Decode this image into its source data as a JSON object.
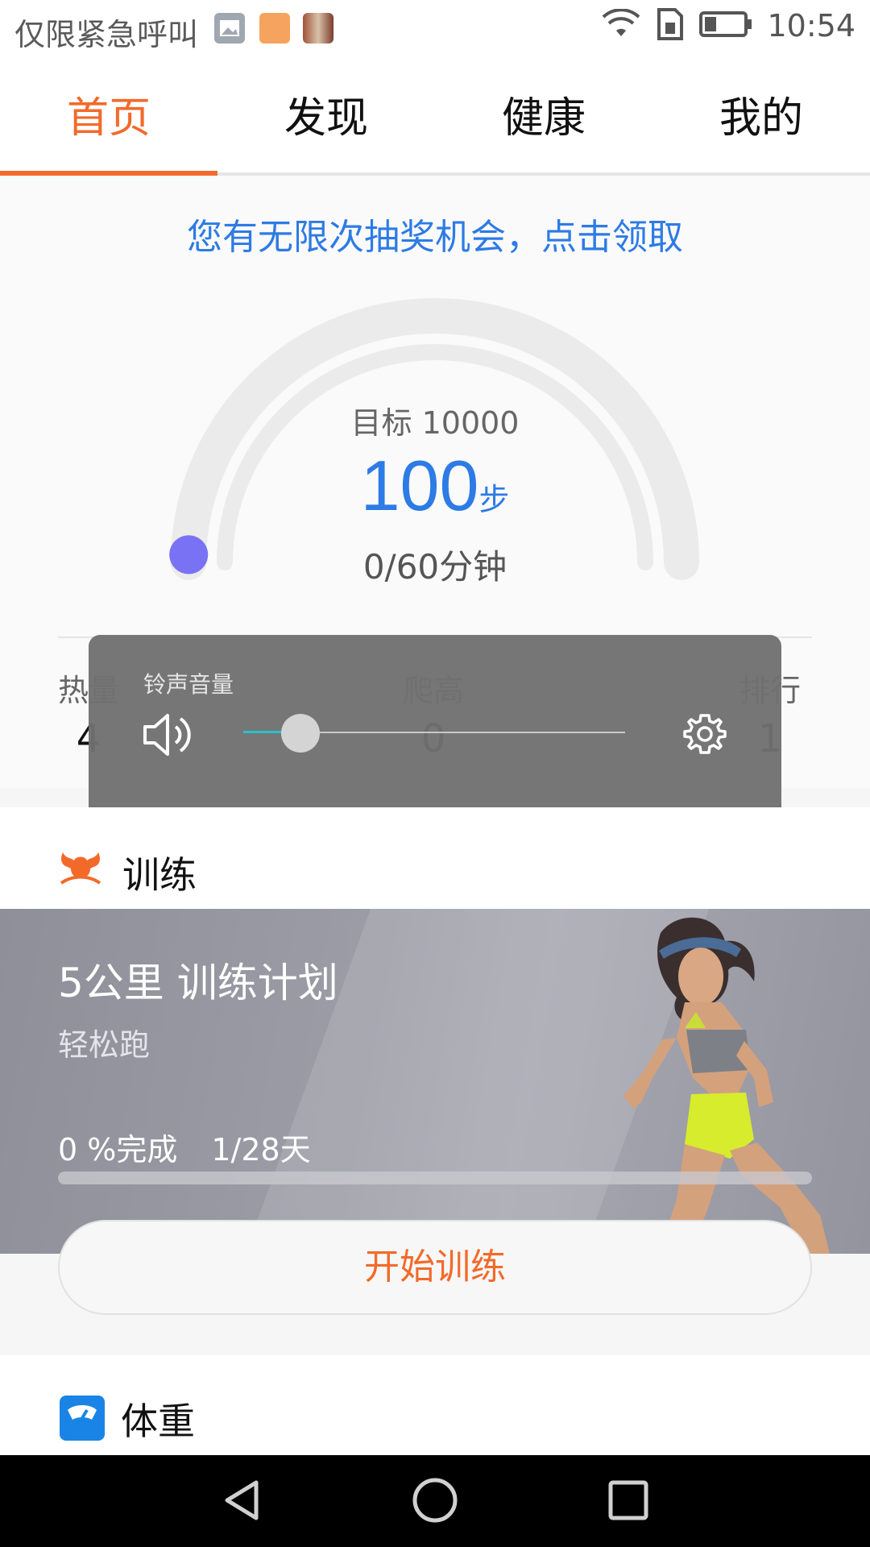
{
  "status_bar": {
    "carrier": "仅限紧急呼叫",
    "time": "10:54",
    "icons": [
      "image-notification-icon",
      "shop-notification-icon",
      "photo-notification-icon",
      "wifi-icon",
      "sim-icon",
      "battery-icon"
    ]
  },
  "tabs": [
    {
      "label": "首页",
      "active": true
    },
    {
      "label": "发现",
      "active": false
    },
    {
      "label": "健康",
      "active": false
    },
    {
      "label": "我的",
      "active": false
    }
  ],
  "main": {
    "lottery_text": "您有无限次抽奖机会，点击领取",
    "goal_text": "目标 10000",
    "steps": "100",
    "steps_unit": "步",
    "progress_fraction": 0.01,
    "minutes_text": "0/60分钟",
    "stats": [
      {
        "label": "热量",
        "value": "4"
      },
      {
        "label": "爬高",
        "value": "0"
      },
      {
        "label": "排行",
        "value": "1"
      }
    ]
  },
  "volume_overlay": {
    "title": "铃声音量",
    "level_fraction": 0.15,
    "speaker_icon": "speaker-icon",
    "settings_icon": "gear-icon"
  },
  "training": {
    "section_title": "训练",
    "plan_title": "5公里 训练计划",
    "plan_subtitle": "轻松跑",
    "completion": "0 %完成",
    "day_progress": "1/28天",
    "completion_fraction": 0,
    "start_button": "开始训练"
  },
  "weight": {
    "section_title": "体重"
  },
  "nav": [
    "back-icon",
    "home-icon",
    "recents-icon"
  ],
  "colors": {
    "accent": "#f26a2a",
    "link_blue": "#2d7be5",
    "gauge_dot": "#7a72f5"
  }
}
